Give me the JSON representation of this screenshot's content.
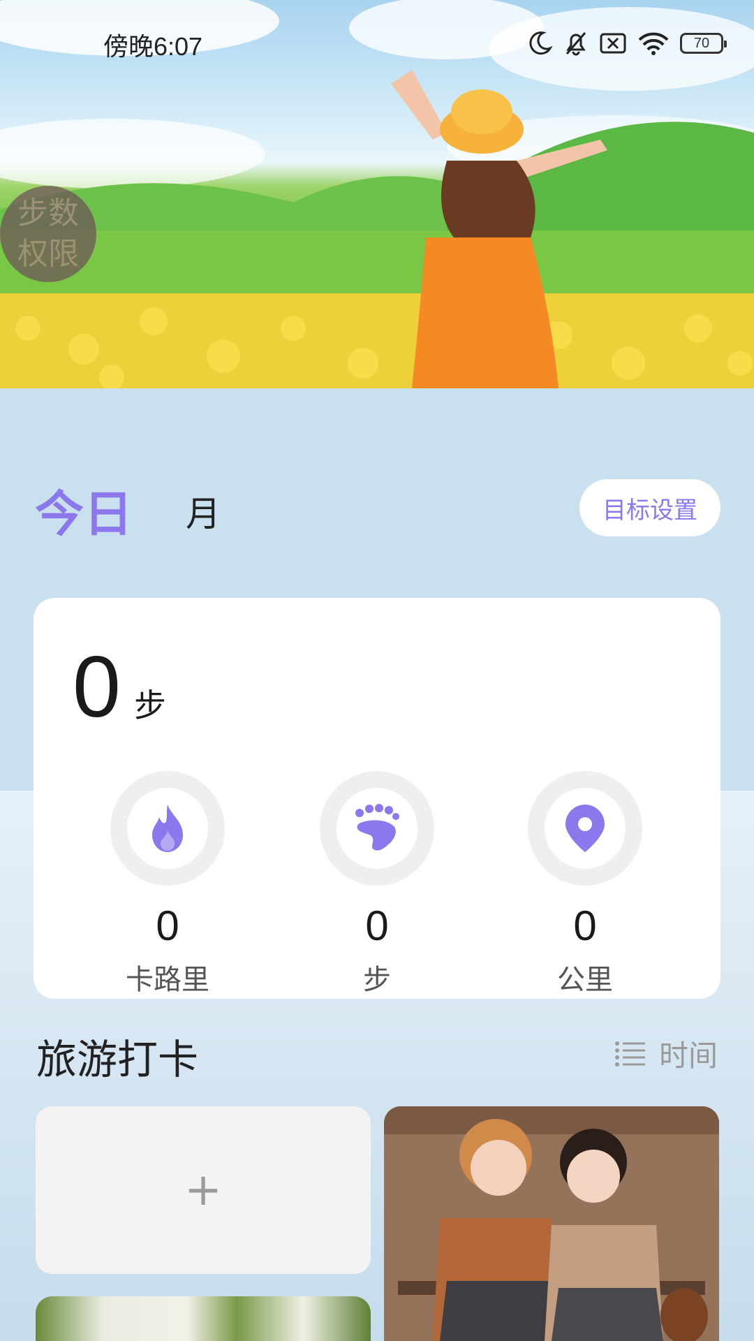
{
  "status_bar": {
    "time": "傍晚6:07",
    "battery": "70",
    "icons": [
      "moon-icon",
      "bell-off-icon",
      "sim-off-icon",
      "wifi-icon",
      "battery-icon"
    ]
  },
  "permission": {
    "line1": "步数",
    "line2": "权限"
  },
  "tabs": {
    "today": "今日",
    "month": "月"
  },
  "goal_button": "目标设置",
  "stats": {
    "steps_value": "0",
    "steps_unit": "步",
    "items": [
      {
        "icon": "flame-icon",
        "value": "0",
        "label": "卡路里"
      },
      {
        "icon": "footprint-icon",
        "value": "0",
        "label": "步"
      },
      {
        "icon": "location-pin-icon",
        "value": "0",
        "label": "公里"
      }
    ]
  },
  "travel": {
    "title": "旅游打卡",
    "sort_label": "时间",
    "add_label": "+"
  },
  "colors": {
    "accent": "#8c78ec",
    "background": "#c9e0ee",
    "card": "#ffffff"
  }
}
